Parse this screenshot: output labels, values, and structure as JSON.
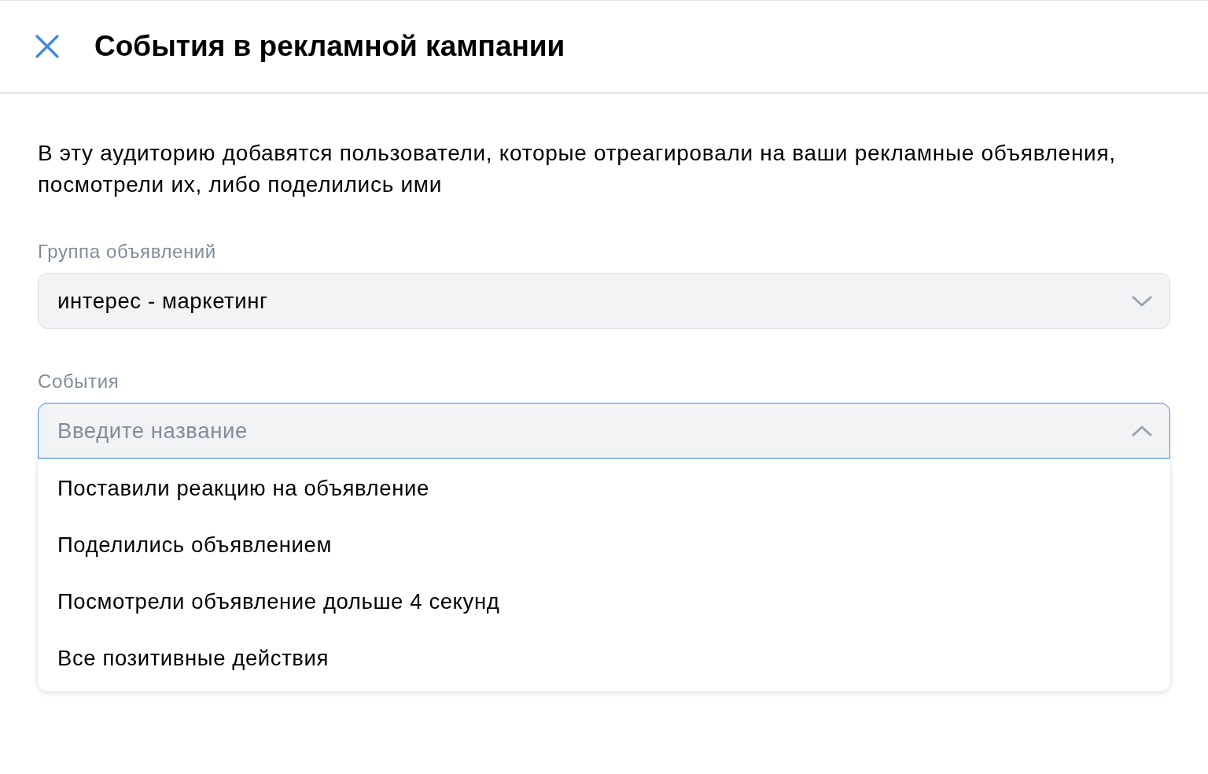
{
  "header": {
    "title": "События в рекламной кампании"
  },
  "description": "В эту аудиторию добавятся пользователи, которые отреагировали на ваши рекламные объявления, посмотрели их, либо поделились ими",
  "fields": [
    {
      "label": "Группа объявлений",
      "value": "интерес - маркетинг",
      "expanded": false
    },
    {
      "label": "События",
      "placeholder": "Введите название",
      "expanded": true,
      "options": [
        "Поставили реакцию на объявление",
        "Поделились объявлением",
        "Посмотрели объявление дольше 4 секунд",
        "Все позитивные действия"
      ]
    }
  ]
}
